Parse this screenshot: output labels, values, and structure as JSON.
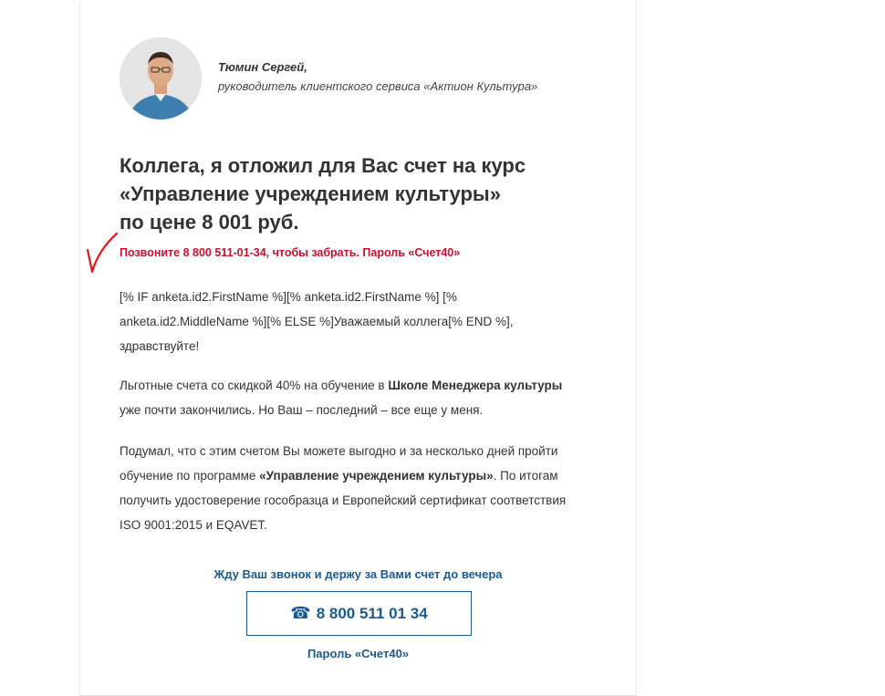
{
  "author": {
    "name": "Тюмин Сергей,",
    "role": "руководитель клиентского сервиса «Актион Культура»"
  },
  "headline": {
    "line1": "Коллега, я отложил для Вас счет на курс",
    "line2": "«Управление учреждением культуры»",
    "line3": "по цене 8 001 руб."
  },
  "alert": "Позвоните 8 800 511-01-34, чтобы забрать. Пароль «Счет40»",
  "greeting": {
    "line1": "[% IF anketa.id2.FirstName %][% anketa.id2.FirstName %] [%",
    "line2": "anketa.id2.MiddleName %][% ELSE %]Уважаемый коллега[% END %],",
    "line3": "здравствуйте!"
  },
  "para2": {
    "text1": "Льготные счета со скидкой 40% на обучение в ",
    "bold1": "Школе Менеджера культуры",
    "text2": "уже почти закончились. Но Ваш – последний – все еще у меня."
  },
  "para3": {
    "line1": "Подумал, что с этим счетом Вы можете выгодно и за несколько дней пройти",
    "text2a": "обучение по программе ",
    "bold2": "«Управление учреждением культуры»",
    "text2b": ". По итогам",
    "line3": "получить удостоверение гособразца и Европейский сертификат соответствия",
    "line4": "ISO 9001:2015 и EQAVET."
  },
  "cta": {
    "text": "Жду Ваш звонок и держу за Вами счет до вечера",
    "phone_icon": "phone-icon",
    "phone": "8 800 511 01 34",
    "password": "Пароль «Счет40»"
  },
  "colors": {
    "accent_blue": "#1b5a8f",
    "alert_red": "#c8102e",
    "check_red": "#e0181f"
  }
}
